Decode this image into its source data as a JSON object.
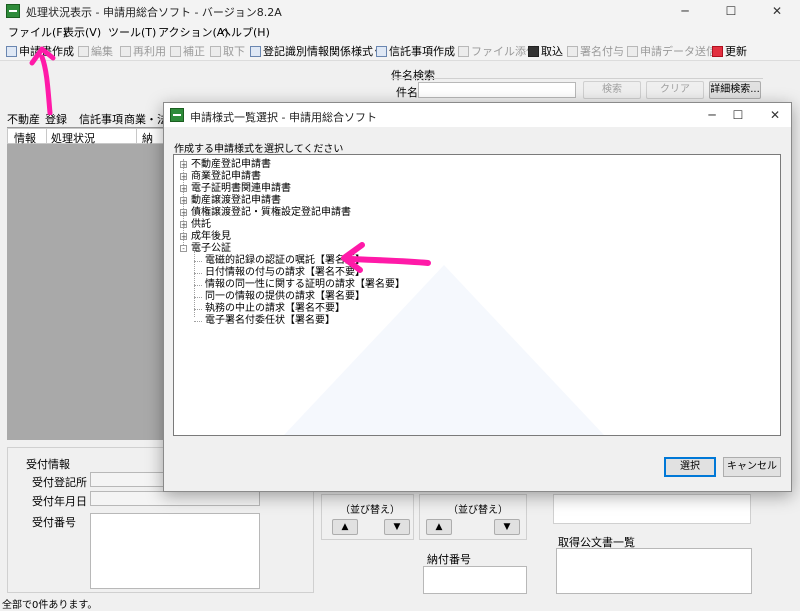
{
  "window": {
    "title": "処理状況表示 - 申請用総合ソフト - バージョン8.2A",
    "controls": [
      "─",
      "☐",
      "✕"
    ]
  },
  "menu": [
    "ファイル(F)",
    "表示(V)",
    "ツール(T)",
    "アクション(A)",
    "ヘルプ(H)"
  ],
  "toolbar": {
    "create": "申請書作成",
    "edit": "編集",
    "reuse": "再利用",
    "amend": "補正",
    "withdraw": "取下",
    "registry_forms": "登記識別情報関係様式",
    "trust": "信託事項作成",
    "attach": "ファイル添付",
    "fetch": "取込",
    "sign": "署名付与",
    "send": "申請データ送信",
    "refresh": "更新"
  },
  "search": {
    "group_label": "件名検索",
    "field_label": "件名",
    "value": "",
    "search_button": "検索",
    "clear_button": "クリア",
    "detail_button": "詳細検索..."
  },
  "tabs": [
    "不動産",
    "登録",
    "信託事項",
    "商業・法人"
  ],
  "list_headers": [
    "情報",
    "処理状況",
    "納付"
  ],
  "reception": {
    "title": "受付情報",
    "office_label": "受付登記所",
    "date_label": "受付年月日",
    "number_label": "受付番号"
  },
  "bottom": {
    "sort_label_1": "（並び替え）",
    "sort_label_2": "（並び替え）",
    "up": "▲",
    "down": "▼",
    "payment_label": "納付番号",
    "documents_label": "取得公文書一覧"
  },
  "status_text": "全部で0件あります。",
  "dialog": {
    "title": "申請様式一覧選択 - 申請用総合ソフト",
    "controls": [
      "─",
      "☐",
      "✕"
    ],
    "instruction": "作成する申請様式を選択してください",
    "tree": [
      {
        "label": "不動産登記申請書",
        "expand": "+"
      },
      {
        "label": "商業登記申請書",
        "expand": "+"
      },
      {
        "label": "電子証明書関連申請書",
        "expand": "+"
      },
      {
        "label": "動産譲渡登記申請書",
        "expand": "+"
      },
      {
        "label": "債権譲渡登記・質権設定登記申請書",
        "expand": "+"
      },
      {
        "label": "供託",
        "expand": "+"
      },
      {
        "label": "成年後見",
        "expand": "+"
      },
      {
        "label": "電子公証",
        "expand": "-"
      }
    ],
    "children": [
      "電磁的記録の認証の嘱託【署名要】",
      "日付情報の付与の請求【署名不要】",
      "情報の同一性に関する証明の請求【署名要】",
      "同一の情報の提供の請求【署名要】",
      "執務の中止の請求【署名不要】",
      "電子署名付委任状【署名要】"
    ],
    "select_button": "選択",
    "cancel_button": "キャンセル"
  },
  "colors": {
    "annotation": "#ff1aa8",
    "accent": "#0078d7"
  }
}
